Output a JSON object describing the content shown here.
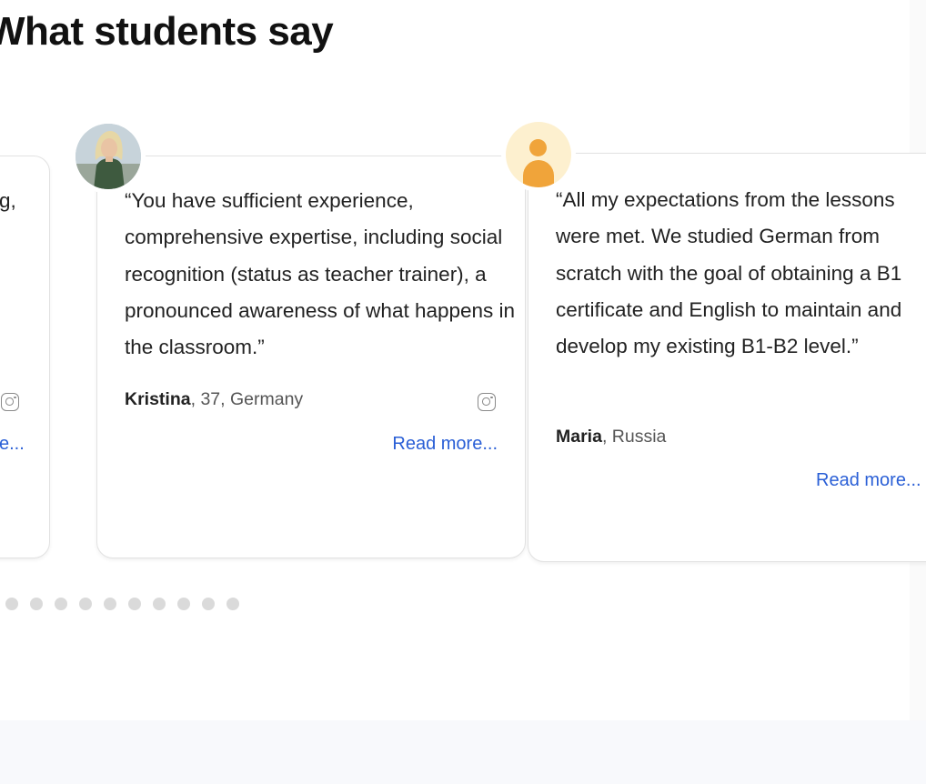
{
  "section": {
    "title": "What students say"
  },
  "testimonials": [
    {
      "partial_text": "g,",
      "read_more": "e..."
    },
    {
      "quote": "“You have sufficient experience, comprehensive expertise, including social recognition (status as teacher trainer), a pronounced awareness of what happens in the classroom.”",
      "name": "Kristina",
      "details": ", 37, Germany",
      "read_more": "Read more..."
    },
    {
      "quote": "“All my expectations from the lessons were met. We studied German from scratch with the goal of obtaining a B1 certificate and English to maintain and develop my existing B1-B2 level.”",
      "name": "Maria",
      "details": ", Russia",
      "read_more": "Read more..."
    }
  ],
  "icons": {
    "social": "instagram-icon",
    "avatar_placeholder": "user-icon"
  },
  "colors": {
    "link": "#2a5fd6",
    "avatar_accent": "#f0a43a",
    "avatar_bg": "#fdf0cf",
    "dot": "#dadada"
  },
  "pagination": {
    "count": 10
  }
}
